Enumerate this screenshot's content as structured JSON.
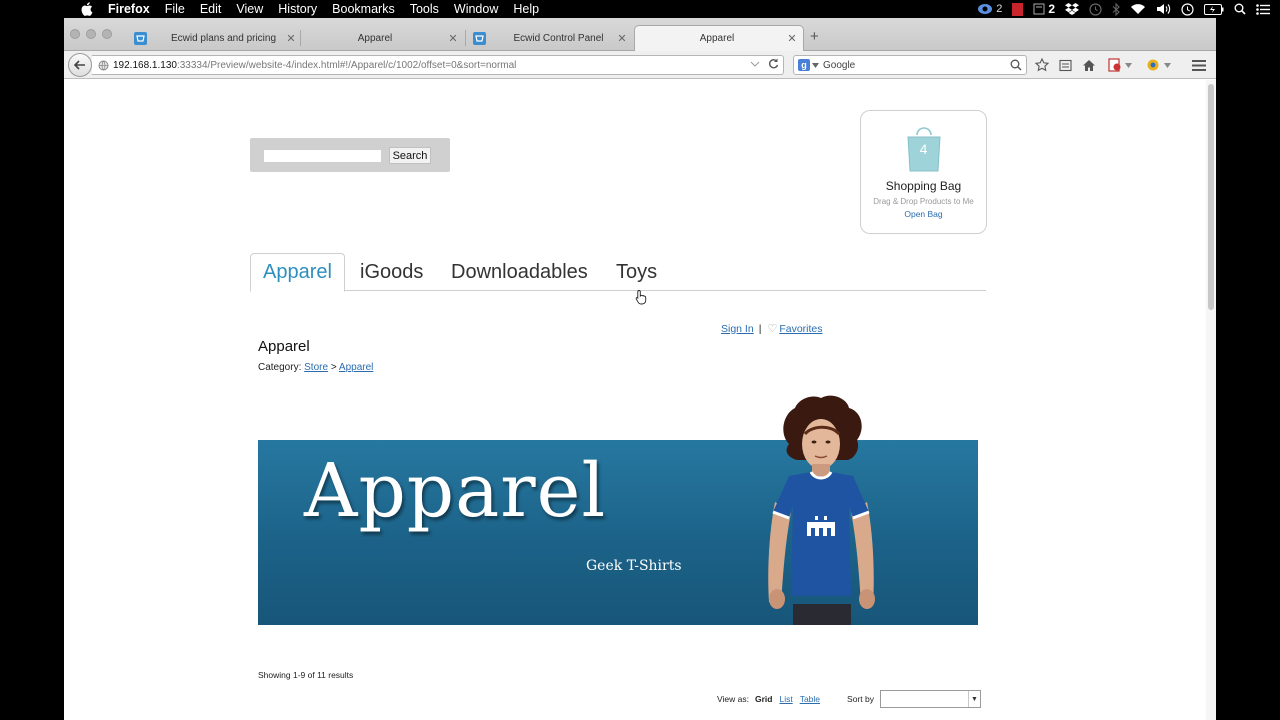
{
  "menubar": {
    "app": "Firefox",
    "items": [
      "File",
      "Edit",
      "View",
      "History",
      "Bookmarks",
      "Tools",
      "Window",
      "Help"
    ],
    "tray": {
      "badge_1": "2",
      "badge_2": "2"
    }
  },
  "browser": {
    "tabs": [
      {
        "label": "Ecwid plans and pricing"
      },
      {
        "label": "Apparel"
      },
      {
        "label": "Ecwid Control Panel"
      },
      {
        "label": "Apparel"
      }
    ],
    "url_host": "192.168.1.130",
    "url_path": ":33334/Preview/website-4/index.html#!/Apparel/c/1002/offset=0&sort=normal",
    "search_placeholder": "Google"
  },
  "store": {
    "search_button": "Search",
    "bag": {
      "count": "4",
      "title": "Shopping Bag",
      "subtitle": "Drag & Drop Products to Me",
      "link": "Open Bag"
    },
    "category_tabs": [
      "Apparel",
      "iGoods",
      "Downloadables",
      "Toys"
    ],
    "signin": "Sign In",
    "separator": "|",
    "favorites": "Favorites",
    "page_title": "Apparel",
    "breadcrumb": {
      "label": "Category:",
      "store": "Store",
      "sep": ">",
      "current": "Apparel"
    },
    "banner": {
      "title": "Apparel",
      "subtitle": "Geek T-Shirts"
    },
    "results": "Showing 1-9 of 11 results",
    "view_as_label": "View as:",
    "view_grid": "Grid",
    "view_list": "List",
    "view_table": "Table",
    "sort_label": "Sort by"
  },
  "colors": {
    "accent": "#2c8fbf",
    "link": "#2a6db0",
    "banner": "#1c6288"
  }
}
